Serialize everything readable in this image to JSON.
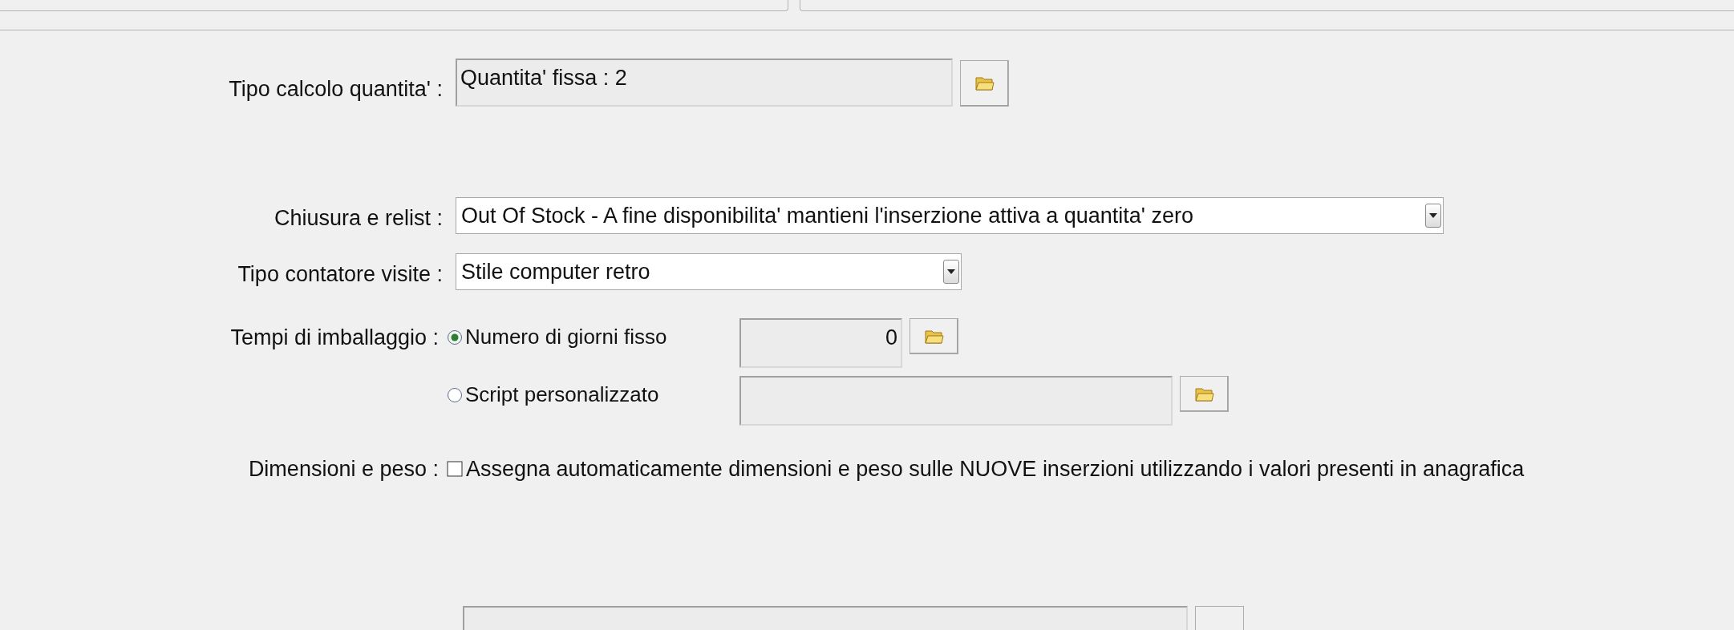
{
  "rows": [
    {
      "kind": "field_button",
      "label": "Tipo calcolo quantita' :",
      "value": "Quantita' fissa : 2",
      "disabled": true
    },
    {
      "kind": "dropdown",
      "label": "Chiusura e relist :",
      "value": "Out Of Stock - A fine disponibilita' mantieni l'inserzione attiva a quantita' zero",
      "wide": true
    },
    {
      "kind": "dropdown",
      "label": "Tipo contatore visite :",
      "value": "Stile computer retro",
      "wide": false
    },
    {
      "kind": "radio_group",
      "label": "Tempi di imballaggio :",
      "options": [
        {
          "label": "Numero di giorni fisso",
          "selected": true,
          "value": "0"
        },
        {
          "label": "Script personalizzato",
          "selected": false
        }
      ]
    },
    {
      "kind": "checkbox",
      "label": "Dimensioni e peso :",
      "text": "Assegna automaticamente dimensioni e peso sulle NUOVE inserzioni utilizzando i valori presenti in anagrafica",
      "checked": false
    },
    {
      "kind": "cut_field"
    }
  ]
}
